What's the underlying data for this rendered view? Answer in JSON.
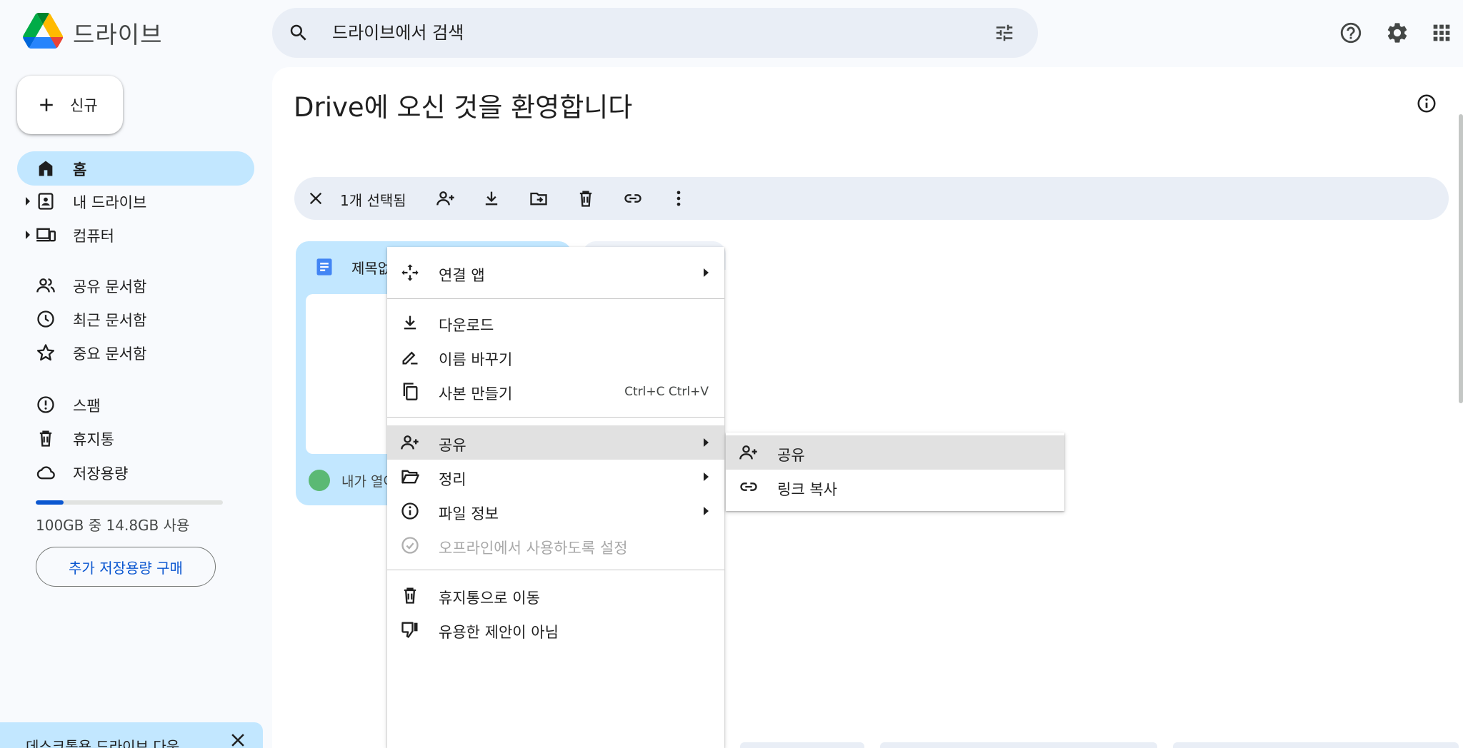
{
  "header": {
    "app_title": "드라이브",
    "search_placeholder": "드라이브에서 검색"
  },
  "sidebar": {
    "new_label": "신규",
    "items": [
      {
        "label": "홈",
        "icon": "home-icon",
        "active": true
      },
      {
        "label": "내 드라이브",
        "icon": "my-drive-icon"
      },
      {
        "label": "컴퓨터",
        "icon": "computers-icon"
      },
      {
        "label": "공유 문서함",
        "icon": "shared-icon"
      },
      {
        "label": "최근 문서함",
        "icon": "clock-icon"
      },
      {
        "label": "중요 문서함",
        "icon": "star-icon"
      },
      {
        "label": "스팸",
        "icon": "spam-icon"
      },
      {
        "label": "휴지통",
        "icon": "trash-icon"
      },
      {
        "label": "저장용량",
        "icon": "cloud-icon"
      }
    ],
    "storage": {
      "used_fraction": 0.148,
      "text": "100GB 중 14.8GB 사용",
      "buy_label": "추가 저장용량 구매"
    },
    "desktop_banner": "데스크톱용 드라이브 다운"
  },
  "main": {
    "title": "Drive에 오신 것을 환영합니다",
    "selection_count": "1개 선택됨"
  },
  "file_card": {
    "name": "제목없",
    "meta": "내가 열어"
  },
  "context_menu": {
    "items": [
      {
        "label": "연결 앱",
        "icon": "open-with-icon",
        "submenu": true
      },
      {
        "label": "다운로드",
        "icon": "download-icon"
      },
      {
        "label": "이름 바꾸기",
        "icon": "rename-icon"
      },
      {
        "label": "사본 만들기",
        "icon": "copy-icon",
        "shortcut": "Ctrl+C Ctrl+V"
      },
      {
        "label": "공유",
        "icon": "share-icon",
        "submenu": true,
        "hovered": true
      },
      {
        "label": "정리",
        "icon": "organize-icon",
        "submenu": true
      },
      {
        "label": "파일 정보",
        "icon": "file-info-icon",
        "submenu": true
      },
      {
        "label": "오프라인에서 사용하도록 설정",
        "icon": "offline-icon",
        "disabled": true
      },
      {
        "label": "휴지통으로 이동",
        "icon": "trash-icon"
      },
      {
        "label": "유용한 제안이 아님",
        "icon": "thumb-down-icon"
      }
    ]
  },
  "share_submenu": {
    "items": [
      {
        "label": "공유",
        "icon": "share-icon",
        "hovered": true
      },
      {
        "label": "링크 복사",
        "icon": "link-icon"
      }
    ]
  },
  "colors": {
    "accent": "#0b57d0",
    "active_nav": "#c2e7ff",
    "search_bg": "#e9eef6"
  }
}
